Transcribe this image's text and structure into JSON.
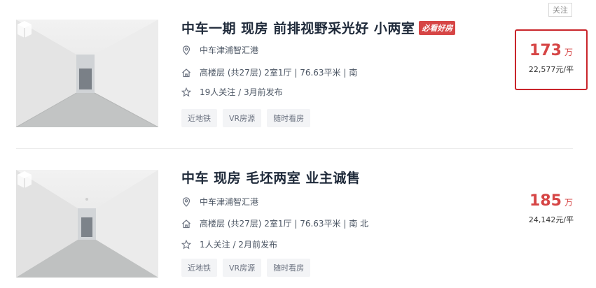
{
  "listings": [
    {
      "title": "中车一期 现房 前排视野采光好 小两室",
      "badge": "必看好房",
      "location": "中车津浦智汇港",
      "attributes": "高楼层 (共27层) 2室1厅 | 76.63平米 | 南",
      "followers": "19人关注 / 3月前发布",
      "tags": [
        "近地铁",
        "VR房源",
        "随时看房"
      ],
      "price": "173",
      "price_unit": "万",
      "unit_price": "22,577元/平",
      "follow_label": "关注"
    },
    {
      "title": "中车 现房 毛坯两室 业主诚售",
      "location": "中车津浦智汇港",
      "attributes": "高楼层 (共27层) 2室1厅 | 76.63平米 | 南 北",
      "followers": "1人关注 / 2月前发布",
      "tags": [
        "近地铁",
        "VR房源",
        "随时看房"
      ],
      "price": "185",
      "price_unit": "万",
      "unit_price": "24,142元/平"
    }
  ],
  "colors": {
    "price": "#d64545",
    "badge_bg": "#d64545",
    "highlight_border": "#c9252b",
    "title": "#1f2a3a"
  },
  "icons": {
    "location": "location-pin-icon",
    "attributes": "house-icon",
    "followers": "star-icon",
    "vr": "vr-cube-icon"
  }
}
